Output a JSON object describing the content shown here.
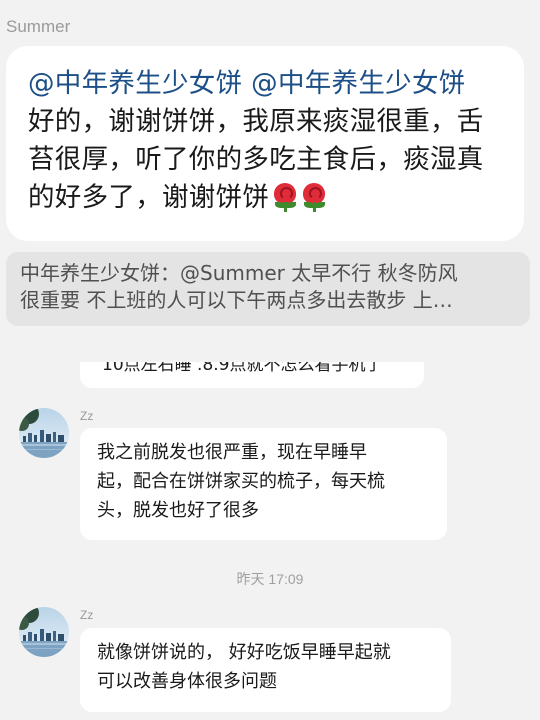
{
  "quoted_message": {
    "sender": "Summer",
    "mention_1": "@中年养生少女饼",
    "mention_2": "@中年养生少女饼",
    "body": "好的，谢谢饼饼，我原来痰湿很重，舌苔很厚，听了你的多吃主食后，痰湿真的好多了，谢谢饼饼",
    "emojis": [
      "rose-emoji",
      "rose-emoji"
    ]
  },
  "reply_preview": {
    "line_1": "中年养生少女饼：@Summer 太早不行 秋冬防风",
    "line_2": "很重要 不上班的人可以下午两点多出去散步 上…"
  },
  "chat": {
    "partial_message": "10点左右睡 .8.9点就不怎么看手机了",
    "messages": [
      {
        "sender": "Zz",
        "avatar": "avatar-lake-skyline",
        "lines": [
          "我之前脱发也很严重，现在早睡早",
          "起，配合在饼饼家买的梳子，每天梳",
          "头，脱发也好了很多"
        ]
      },
      {
        "sender": "Zz",
        "avatar": "avatar-lake-skyline",
        "lines": [
          "就像饼饼说的， 好好吃饭早睡早起就",
          "可以改善身体很多问题"
        ]
      }
    ],
    "timestamp": "昨天 17:09"
  },
  "colors": {
    "background": "#f2f2f2",
    "bubble": "#ffffff",
    "mention": "#1c4f87",
    "quote_bg": "#e4e4e4",
    "secondary_text": "#9a9a9a"
  }
}
